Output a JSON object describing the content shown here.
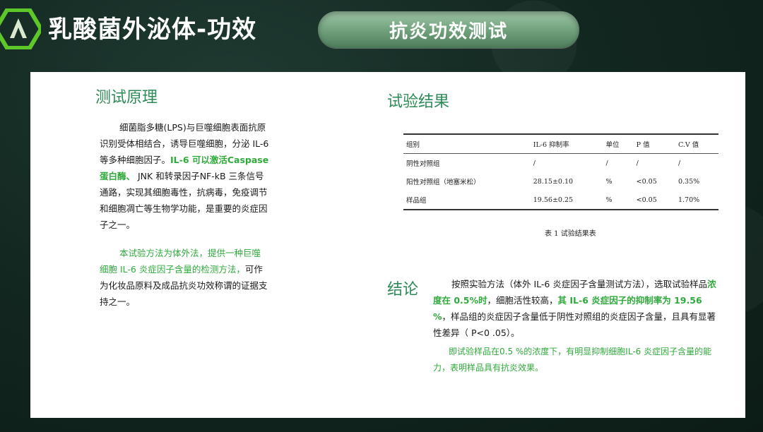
{
  "header": {
    "title": "乳酸菌外泌体-功效",
    "badge": "抗炎功效测试"
  },
  "left": {
    "heading": "测试原理",
    "p1_a": "细菌脂多糖(LPS)与巨噬细胞表面抗原识别受体相结合，诱导巨噬细胞，分泌 IL-6 等多种细胞因子。",
    "p1_b": "IL-6 可以激活Caspase蛋白酶、",
    "p1_c": " JNK 和转录因子NF-kB 三条信号通路，实现其细胞毒性，抗病毒，免疫调节和细胞凋亡等生物学功能，是重要的炎症因子之一。",
    "p2_a": "本试验方法为体外法，提供一种巨噬细胞 IL-6 炎症因子含量的检测方法，",
    "p2_b": "可作为化妆品原料及成品抗炎功效称谓的证据支持之一。"
  },
  "right": {
    "heading_results": "试验结果",
    "table": {
      "headers": [
        "组别",
        "IL-6 抑制率",
        "单位",
        "P 值",
        "C.V 值"
      ],
      "rows": [
        [
          "阴性对照组",
          "/",
          "/",
          "/",
          "/"
        ],
        [
          "阳性对照组（地塞米松）",
          "28.15±0.10",
          "%",
          "<0.05",
          "0.35%"
        ],
        [
          "样品组",
          "19.56±0.25",
          "%",
          "<0.05",
          "1.70%"
        ]
      ]
    },
    "caption": "表 1  试验结果表",
    "heading_conclusion": "结论",
    "c1_a": "按照实验方法（体外 IL-6 炎症因子含量测试方法），选取试验样品",
    "c1_b": "浓度在 0.5%时",
    "c1_c": "，细胞活性较高，",
    "c1_d": "其 IL-6 炎症因子的抑制率为 19.56 %",
    "c1_e": "，样品组的炎症因子含量低于阴性对照组的炎症因子含量，且具有显著性差异（ P<0 .05）。",
    "c2": "即试验样品在0.5 %的浓度下，有明显抑制细胞IL-6 炎症因子含量的能力，表明样品具有抗炎效果。"
  }
}
